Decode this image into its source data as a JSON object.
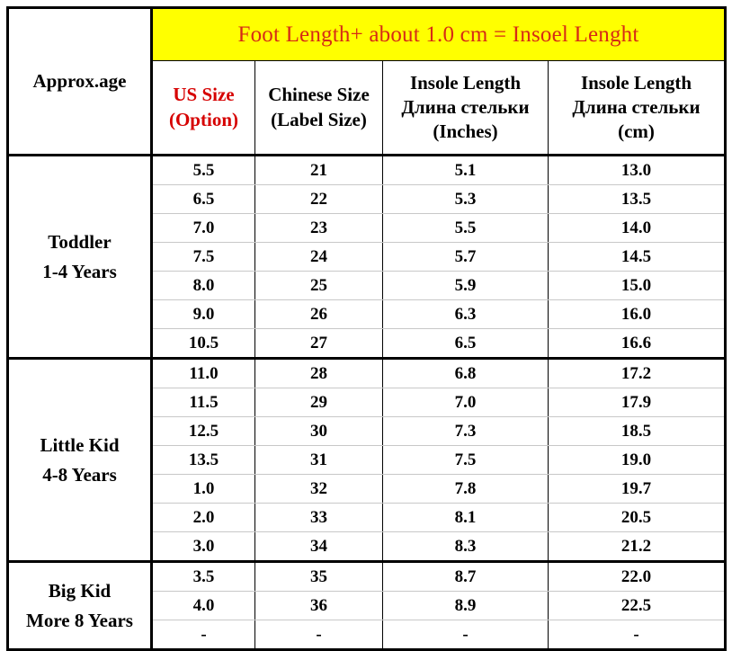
{
  "banner": {
    "text": "Foot Length+ about 1.0 cm = Insoel Lenght",
    "background_color": "#ffff00",
    "text_color": "#d62b16"
  },
  "header": {
    "approx_age": "Approx.age",
    "us_size": {
      "line1": "US Size",
      "line2": "(Option)",
      "color": "#d60000"
    },
    "chinese_size": {
      "line1": "Chinese Size",
      "line2": "(Label Size)"
    },
    "insole_inches": {
      "line1": "Insole Length",
      "line2": "Длина стельки",
      "line3": "(Inches)"
    },
    "insole_cm": {
      "line1": "Insole Length",
      "line2": "Длина стельки",
      "line3": "(cm)"
    }
  },
  "groups": [
    {
      "label_line1": "Toddler",
      "label_line2": "1-4 Years",
      "rows": [
        {
          "us": "5.5",
          "cn": "21",
          "inch": "5.1",
          "cm": "13.0"
        },
        {
          "us": "6.5",
          "cn": "22",
          "inch": "5.3",
          "cm": "13.5"
        },
        {
          "us": "7.0",
          "cn": "23",
          "inch": "5.5",
          "cm": "14.0"
        },
        {
          "us": "7.5",
          "cn": "24",
          "inch": "5.7",
          "cm": "14.5"
        },
        {
          "us": "8.0",
          "cn": "25",
          "inch": "5.9",
          "cm": "15.0"
        },
        {
          "us": "9.0",
          "cn": "26",
          "inch": "6.3",
          "cm": "16.0"
        },
        {
          "us": "10.5",
          "cn": "27",
          "inch": "6.5",
          "cm": "16.6"
        }
      ]
    },
    {
      "label_line1": "Little Kid",
      "label_line2": "4-8 Years",
      "rows": [
        {
          "us": "11.0",
          "cn": "28",
          "inch": "6.8",
          "cm": "17.2"
        },
        {
          "us": "11.5",
          "cn": "29",
          "inch": "7.0",
          "cm": "17.9"
        },
        {
          "us": "12.5",
          "cn": "30",
          "inch": "7.3",
          "cm": "18.5"
        },
        {
          "us": "13.5",
          "cn": "31",
          "inch": "7.5",
          "cm": "19.0"
        },
        {
          "us": "1.0",
          "cn": "32",
          "inch": "7.8",
          "cm": "19.7"
        },
        {
          "us": "2.0",
          "cn": "33",
          "inch": "8.1",
          "cm": "20.5"
        },
        {
          "us": "3.0",
          "cn": "34",
          "inch": "8.3",
          "cm": "21.2"
        }
      ]
    },
    {
      "label_line1": "Big Kid",
      "label_line2": "More 8 Years",
      "rows": [
        {
          "us": "3.5",
          "cn": "35",
          "inch": "8.7",
          "cm": "22.0"
        },
        {
          "us": "4.0",
          "cn": "36",
          "inch": "8.9",
          "cm": "22.5"
        },
        {
          "us": "-",
          "cn": "-",
          "inch": "-",
          "cm": "-"
        }
      ]
    }
  ]
}
